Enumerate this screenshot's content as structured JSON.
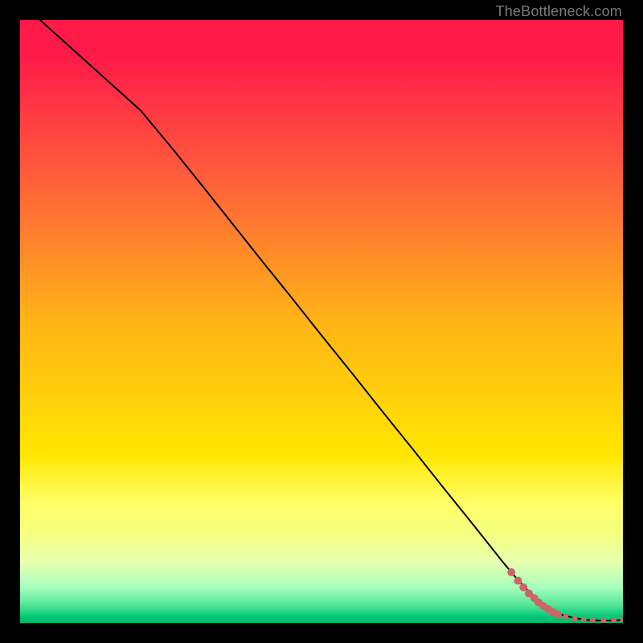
{
  "attribution": "TheBottleneck.com",
  "chart_data": {
    "type": "line",
    "title": "",
    "xlabel": "",
    "ylabel": "",
    "xlim": [
      0,
      100
    ],
    "ylim": [
      0,
      100
    ],
    "grid": false,
    "legend": false,
    "series": [
      {
        "name": "bottleneck-curve",
        "type": "line",
        "color": "#000000",
        "width": 2,
        "x": [
          0,
          5,
          10,
          15,
          20,
          25,
          30,
          35,
          40,
          45,
          50,
          55,
          60,
          65,
          70,
          75,
          80,
          82,
          84,
          86,
          88,
          90,
          92,
          94,
          96,
          98,
          100
        ],
        "y": [
          103,
          98.5,
          94,
          89.5,
          85,
          79,
          72.8,
          66.5,
          60.2,
          54,
          47.7,
          41.5,
          35.2,
          29,
          22.7,
          16.5,
          10.2,
          7.8,
          5.6,
          3.7,
          2.3,
          1.3,
          0.8,
          0.5,
          0.4,
          0.4,
          0.5
        ]
      },
      {
        "name": "highlight-dots",
        "type": "scatter",
        "color": "#cc6666",
        "radius_main": 5,
        "radius_small": 3.5,
        "points": [
          {
            "x": 81.5,
            "y": 8.4
          },
          {
            "x": 82.6,
            "y": 7.0
          },
          {
            "x": 83.5,
            "y": 5.9
          },
          {
            "x": 84.4,
            "y": 4.9
          },
          {
            "x": 85.3,
            "y": 4.1
          },
          {
            "x": 86.0,
            "y": 3.4
          },
          {
            "x": 86.8,
            "y": 2.8
          },
          {
            "x": 87.6,
            "y": 2.3
          },
          {
            "x": 88.4,
            "y": 1.8
          },
          {
            "x": 89.2,
            "y": 1.4
          },
          {
            "x": 90.5,
            "y": 1.0
          },
          {
            "x": 92.0,
            "y": 0.7
          },
          {
            "x": 93.5,
            "y": 0.55
          },
          {
            "x": 95.0,
            "y": 0.5
          },
          {
            "x": 96.8,
            "y": 0.45
          },
          {
            "x": 98.5,
            "y": 0.5
          },
          {
            "x": 100.0,
            "y": 0.6
          }
        ]
      }
    ],
    "gradient_zones_note": "background gradient red→yellow→green top-to-bottom within plot area"
  },
  "colors": {
    "frame_background": "#000000",
    "curve": "#000000",
    "dots": "#cc6666",
    "attribution_text": "#7a7a7a"
  }
}
